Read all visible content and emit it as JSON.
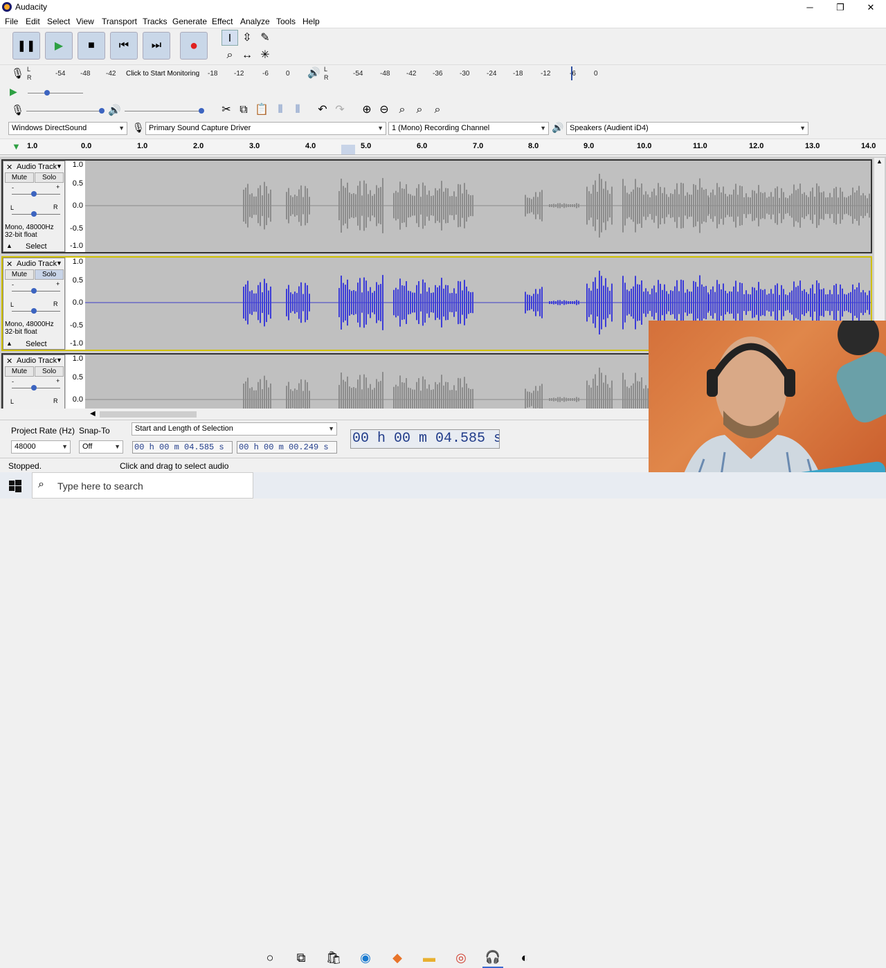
{
  "window": {
    "title": "Audacity",
    "minimize": "─",
    "restore": "❐",
    "close": "✕"
  },
  "menu": [
    "File",
    "Edit",
    "Select",
    "View",
    "Transport",
    "Tracks",
    "Generate",
    "Effect",
    "Analyze",
    "Tools",
    "Help"
  ],
  "meters": {
    "record_ticks": [
      "-54",
      "-48",
      "-42",
      "-18",
      "-12",
      "-6",
      "0"
    ],
    "monitor_label": "Click to Start Monitoring",
    "play_ticks": [
      "-54",
      "-48",
      "-42",
      "-36",
      "-30",
      "-24",
      "-18",
      "-12",
      "-6",
      "0"
    ],
    "lr_top": "L",
    "lr_bottom": "R"
  },
  "device": {
    "host": "Windows DirectSound",
    "recording_device": "Primary Sound Capture Driver",
    "channels": "1 (Mono) Recording Channel",
    "playback_device": "Speakers (Audient iD4)"
  },
  "timeline": {
    "ticks": [
      "1.0",
      "0.0",
      "1.0",
      "2.0",
      "3.0",
      "4.0",
      "5.0",
      "6.0",
      "7.0",
      "8.0",
      "9.0",
      "10.0",
      "11.0",
      "12.0",
      "13.0",
      "14.0"
    ]
  },
  "tracks": [
    {
      "name": "Audio Track",
      "close": "✕",
      "mute": "Mute",
      "solo": "Solo",
      "info1": "Mono, 48000Hz",
      "info2": "32-bit float",
      "select": "Select",
      "scale": [
        "1.0",
        "0.5",
        "0.0",
        "-0.5",
        "-1.0"
      ],
      "lr_l": "L",
      "lr_r": "R",
      "gain_minus": "-",
      "gain_plus": "+"
    },
    {
      "name": "Audio Track",
      "close": "✕",
      "mute": "Mute",
      "solo": "Solo",
      "info1": "Mono, 48000Hz",
      "info2": "32-bit float",
      "select": "Select",
      "scale": [
        "1.0",
        "0.5",
        "0.0",
        "-0.5",
        "-1.0"
      ],
      "lr_l": "L",
      "lr_r": "R",
      "gain_minus": "-",
      "gain_plus": "+"
    },
    {
      "name": "Audio Track",
      "close": "✕",
      "mute": "Mute",
      "solo": "Solo",
      "scale": [
        "1.0",
        "0.5",
        "0.0"
      ],
      "lr_l": "L",
      "lr_r": "R",
      "gain_minus": "-",
      "gain_plus": "+"
    }
  ],
  "bottom": {
    "project_rate_label": "Project Rate (Hz)",
    "project_rate": "48000",
    "snap_label": "Snap-To",
    "snap_value": "Off",
    "selection_mode": "Start and Length of Selection",
    "sel_start": "00 h 00 m 04.585 s",
    "sel_length": "00 h 00 m 00.249 s",
    "audio_position": "00 h 00 m 04.585 s"
  },
  "status": {
    "state": "Stopped.",
    "hint": "Click and drag to select audio"
  },
  "taskbar": {
    "search_placeholder": "Type here to search"
  }
}
